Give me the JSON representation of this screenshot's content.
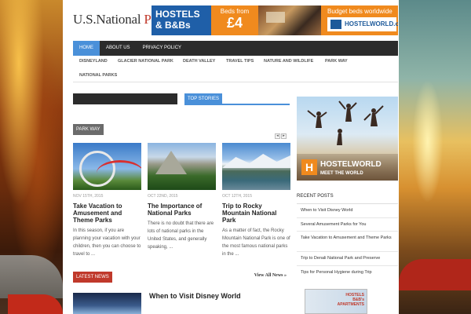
{
  "site": {
    "logo_main": "U.S.National ",
    "logo_accent": "Park"
  },
  "banner": {
    "hostels_line1": "HOSTELS",
    "hostels_line2": "& B&Bs",
    "beds_from": "Beds from",
    "price": "£4",
    "budget": "Budget beds worldwide",
    "hostelworld": "HOSTELWORLD.com"
  },
  "main_nav": [
    {
      "label": "HOME",
      "active": true
    },
    {
      "label": "ABOUT US",
      "active": false
    },
    {
      "label": "PRIVACY POLICY",
      "active": false
    }
  ],
  "sub_nav": [
    "DISNEYLAND",
    "GLACIER NATIONAL PARK",
    "DEATH VALLEY",
    "TRAVEL TIPS",
    "NATURE AND WILDLIFE",
    "PARK WAY",
    "NATIONAL PARKS"
  ],
  "top_stories_label": "TOP STORIES",
  "park_way": {
    "label": "PARK WAY",
    "prev": "◂",
    "next": "▸",
    "articles": [
      {
        "date": "NOV 15TH, 2015",
        "title": "Take Vacation to Amusement and Theme Parks",
        "excerpt": "In this season, if you are planning your vacation with your children, then you can choose to travel to ..."
      },
      {
        "date": "OCT 22ND, 2015",
        "title": "The Importance of National Parks",
        "excerpt": "There is no doubt that there are lots of national parks in the United States, and generally speaking, ..."
      },
      {
        "date": "OCT 12TH, 2015",
        "title": "Trip to Rocky Mountain National Park",
        "excerpt": "As a matter of fact, the Rocky Mountain National Park is one of the most famous national parks in the ..."
      }
    ]
  },
  "latest_news": {
    "label": "LATEST NEWS",
    "view_all": "View All News »",
    "first_title": "When to Visit Disney World"
  },
  "sidebar_ad": {
    "logo_letter": "H",
    "brand": "HOSTELWORLD",
    "tagline": "MEET THE WORLD"
  },
  "recent_posts": {
    "label": "RECENT POSTS",
    "items": [
      "When to Visit Disney World",
      "Several Amusement Parks for You",
      "Take Vacation to Amusement and Theme Parks",
      "Trip to Denali National Park and Preserve",
      "Tips for Personal Hygiene during Trip"
    ]
  },
  "small_ad": {
    "line1": "HOSTELS",
    "line2": "B&B's",
    "line3": "APARTMENTS"
  },
  "colors": {
    "accent_blue": "#4a90d9",
    "accent_red": "#c0392b",
    "nav_dark": "#2b2b2b"
  }
}
